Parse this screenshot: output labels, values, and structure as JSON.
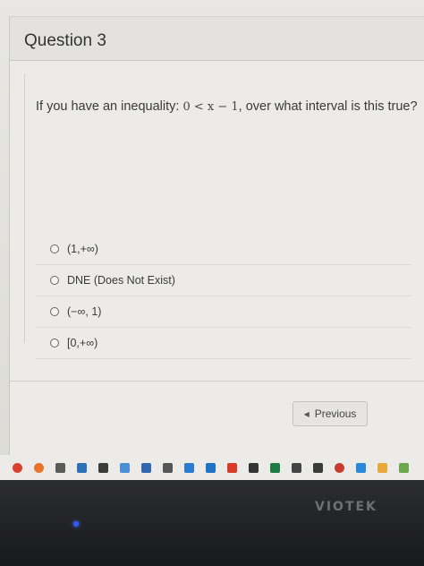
{
  "question": {
    "title": "Question 3",
    "text_before": "If you have an inequality: ",
    "math": "0 < x − 1",
    "text_after": ", over what interval is this true?"
  },
  "options": [
    {
      "label": "(1,+∞)"
    },
    {
      "label": "DNE (Does Not Exist)"
    },
    {
      "label": "(−∞, 1)"
    },
    {
      "label": "[0,+∞)"
    }
  ],
  "navigation": {
    "previous_label": "Previous",
    "previous_icon": "caret-left-icon"
  },
  "taskbar": {
    "icons": [
      {
        "name": "chrome-icon",
        "color": "#d9412f"
      },
      {
        "name": "firefox-icon",
        "color": "#e8732a"
      },
      {
        "name": "app-icon",
        "color": "#5a5a5a"
      },
      {
        "name": "app-icon",
        "color": "#2f6fb8"
      },
      {
        "name": "app-icon",
        "color": "#3b3b3b"
      },
      {
        "name": "app-icon",
        "color": "#4a8fd6"
      },
      {
        "name": "app-icon",
        "color": "#3266b0"
      },
      {
        "name": "app-icon",
        "color": "#555555"
      },
      {
        "name": "app-icon",
        "color": "#2a7bd0"
      },
      {
        "name": "app-icon",
        "color": "#1e73c9"
      },
      {
        "name": "app-icon",
        "color": "#d83b2a"
      },
      {
        "name": "app-icon",
        "color": "#333333"
      },
      {
        "name": "excel-icon",
        "color": "#1f7a44"
      },
      {
        "name": "app-icon",
        "color": "#444444"
      },
      {
        "name": "xbox-icon",
        "color": "#3a3a3a"
      },
      {
        "name": "app-icon",
        "color": "#c83b2e"
      },
      {
        "name": "app-icon",
        "color": "#2b88d8"
      },
      {
        "name": "app-icon",
        "color": "#e8a93a"
      },
      {
        "name": "app-icon",
        "color": "#6aa84f"
      }
    ]
  },
  "monitor": {
    "brand": "VIOTEK"
  }
}
